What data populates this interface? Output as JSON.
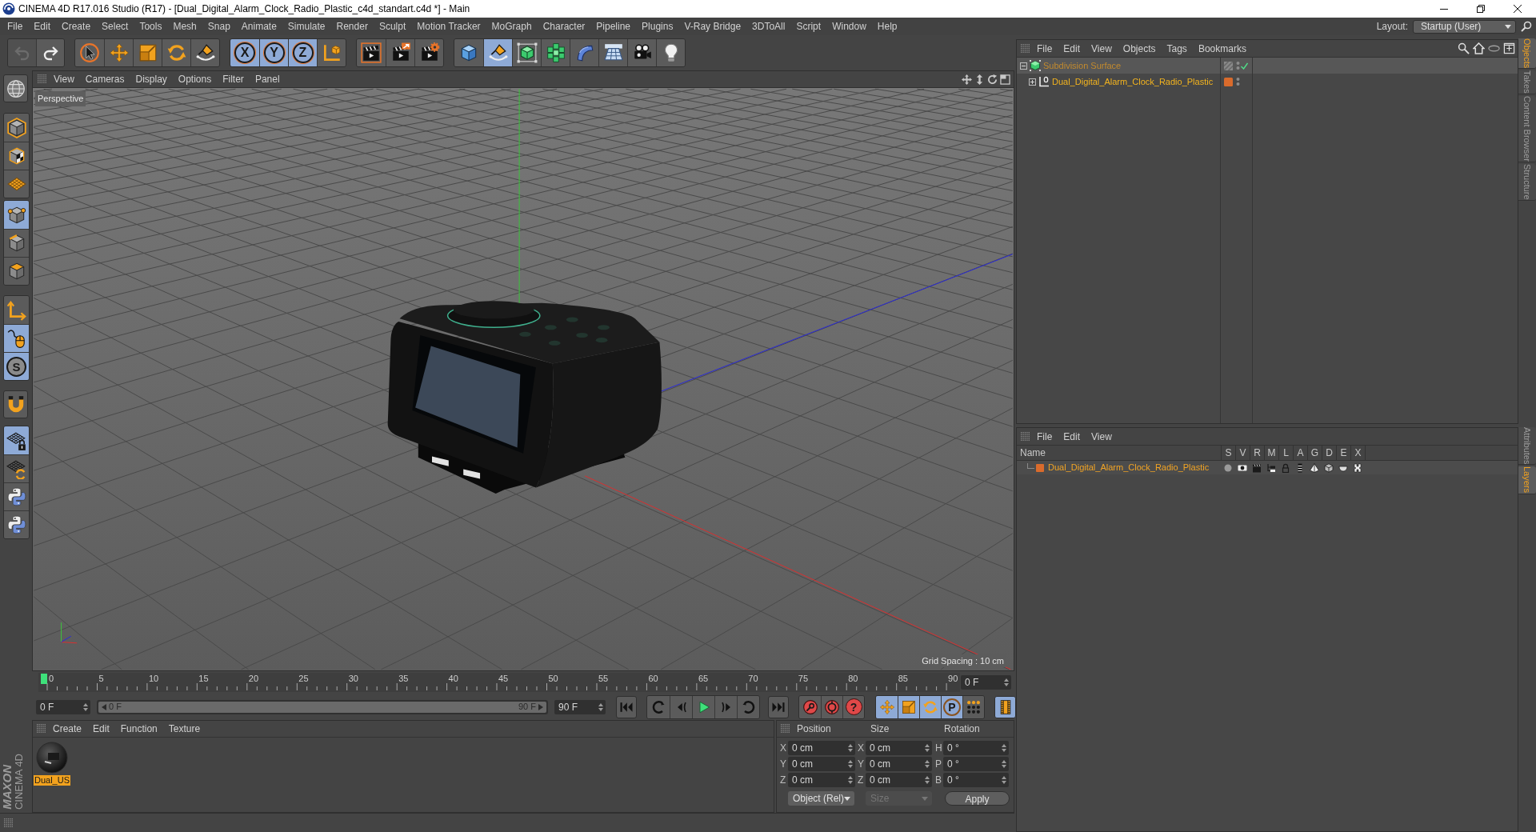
{
  "window": {
    "title": "CINEMA 4D R17.016 Studio (R17) - [Dual_Digital_Alarm_Clock_Radio_Plastic_c4d_standart.c4d *] - Main"
  },
  "menu_bar": {
    "items": [
      "File",
      "Edit",
      "Create",
      "Select",
      "Tools",
      "Mesh",
      "Snap",
      "Animate",
      "Simulate",
      "Render",
      "Sculpt",
      "Motion Tracker",
      "MoGraph",
      "Character",
      "Pipeline",
      "Plugins",
      "V-Ray Bridge",
      "3DToAll",
      "Script",
      "Window",
      "Help"
    ],
    "layout_label": "Layout:",
    "layout_value": "Startup (User)"
  },
  "toolbar": {
    "history": [
      {
        "kind": "undo",
        "disabled": true
      },
      {
        "kind": "redo",
        "disabled": false
      }
    ],
    "groups": [
      [
        {
          "kind": "select",
          "selected": false
        },
        {
          "kind": "move",
          "selected": false
        },
        {
          "kind": "scale",
          "selected": false
        },
        {
          "kind": "rotate",
          "selected": false
        },
        {
          "kind": "brush",
          "selected": false
        }
      ],
      [
        {
          "kind": "axis",
          "label": "X",
          "selected": true
        },
        {
          "kind": "axis",
          "label": "Y",
          "selected": true
        },
        {
          "kind": "axis",
          "label": "Z",
          "selected": true
        },
        {
          "kind": "coords",
          "selected": false
        }
      ],
      [
        {
          "kind": "render-view",
          "selected": false
        },
        {
          "kind": "render-picture",
          "selected": false
        },
        {
          "kind": "render-settings",
          "selected": false
        }
      ],
      [
        {
          "kind": "cube",
          "selected": false
        },
        {
          "kind": "pen",
          "selected": true
        },
        {
          "kind": "subdivision",
          "selected": false
        },
        {
          "kind": "cloner",
          "selected": false
        },
        {
          "kind": "deformer",
          "selected": false
        },
        {
          "kind": "floor",
          "selected": false
        },
        {
          "kind": "camera",
          "selected": false
        },
        {
          "kind": "light",
          "selected": false
        }
      ]
    ]
  },
  "left_toolbar": {
    "groups": [
      [
        {
          "kind": "make-editable",
          "selected": false
        }
      ],
      [
        {
          "kind": "model",
          "selected": false
        },
        {
          "kind": "texture",
          "selected": false
        },
        {
          "kind": "workplane",
          "selected": false
        }
      ],
      [
        {
          "kind": "points",
          "selected": true
        },
        {
          "kind": "edges",
          "selected": false
        },
        {
          "kind": "polygons",
          "selected": false
        }
      ],
      [
        {
          "kind": "axis-mode",
          "selected": false
        },
        {
          "kind": "tweak",
          "selected": true
        },
        {
          "kind": "solo",
          "label": "S",
          "selected": true
        }
      ],
      [
        {
          "kind": "snap",
          "selected": false
        }
      ],
      [
        {
          "kind": "workplane-lock",
          "selected": true
        },
        {
          "kind": "workplane-align",
          "selected": false
        },
        {
          "kind": "python",
          "selected": false
        },
        {
          "kind": "python",
          "selected": false
        }
      ]
    ]
  },
  "viewport": {
    "menu": [
      "View",
      "Cameras",
      "Display",
      "Options",
      "Filter",
      "Panel"
    ],
    "camera": "Perspective",
    "grid_spacing": "Grid Spacing : 10 cm"
  },
  "timeline": {
    "ticks": [
      "0",
      "5",
      "10",
      "15",
      "20",
      "25",
      "30",
      "35",
      "40",
      "45",
      "50",
      "55",
      "60",
      "65",
      "70",
      "75",
      "80",
      "85",
      "90"
    ],
    "playhead": {
      "level": 0
    },
    "frame_field": "0 F"
  },
  "playback": {
    "start_field": "0 F",
    "range": {
      "start": "0 F",
      "end": "90 F",
      "level": 1
    },
    "end_field": "90 F",
    "transport": [
      [
        {
          "kind": "go-start"
        }
      ],
      [
        {
          "kind": "prev-key"
        },
        {
          "kind": "prev-frame"
        },
        {
          "kind": "play"
        },
        {
          "kind": "next-frame"
        },
        {
          "kind": "next-key"
        }
      ],
      [
        {
          "kind": "go-end"
        }
      ]
    ],
    "record": [
      {
        "kind": "record-key"
      },
      {
        "kind": "auto-key"
      },
      {
        "kind": "key-selection",
        "label": "?"
      }
    ],
    "modes": [
      {
        "kind": "key-move",
        "selected": true
      },
      {
        "kind": "key-scale",
        "selected": true
      },
      {
        "kind": "key-rotate",
        "selected": true
      },
      {
        "kind": "param",
        "label": "P",
        "selected": true
      },
      {
        "kind": "dot-grid",
        "selected": false
      }
    ],
    "timeline_toggle": {
      "selected": true
    }
  },
  "material_manager": {
    "menu": [
      "Create",
      "Edit",
      "Function",
      "Texture"
    ],
    "materials": [
      {
        "name": "Dual_US",
        "selected": true
      }
    ]
  },
  "coordinates": {
    "headings": [
      "Position",
      "Size",
      "Rotation"
    ],
    "rows": [
      [
        {
          "axis": "X",
          "value": "0 cm"
        },
        {
          "axis": "X",
          "value": "0 cm"
        },
        {
          "axis": "H",
          "value": "0 °"
        }
      ],
      [
        {
          "axis": "Y",
          "value": "0 cm"
        },
        {
          "axis": "Y",
          "value": "0 cm"
        },
        {
          "axis": "P",
          "value": "0 °"
        }
      ],
      [
        {
          "axis": "Z",
          "value": "0 cm"
        },
        {
          "axis": "Z",
          "value": "0 cm"
        },
        {
          "axis": "B",
          "value": "0 °"
        }
      ]
    ],
    "dropdowns": [
      {
        "label": "Object (Rel)",
        "disabled": false
      },
      {
        "label": "Size",
        "disabled": true
      }
    ],
    "apply": "Apply"
  },
  "object_manager": {
    "menu": [
      "File",
      "Edit",
      "View",
      "Objects",
      "Tags",
      "Bookmarks"
    ],
    "objects": [
      {
        "name": "Subdivision Surface",
        "kind": "subdivision",
        "selected": true,
        "active": false,
        "expanded": true,
        "enabled": true,
        "children": [
          {
            "name": "Dual_Digital_Alarm_Clock_Radio_Plastic",
            "kind": "null",
            "selected": false,
            "active": true,
            "expanded": false,
            "enabled": false,
            "color": "#d96b2c"
          }
        ]
      }
    ]
  },
  "layer_manager": {
    "menu": [
      "File",
      "Edit",
      "View"
    ],
    "columns": [
      "Name",
      "S",
      "V",
      "R",
      "M",
      "L",
      "A",
      "G",
      "D",
      "E",
      "X"
    ],
    "layers": [
      {
        "name": "Dual_Digital_Alarm_Clock_Radio_Plastic",
        "color": "#d96b2c"
      }
    ]
  },
  "side_tabs": {
    "upper": [
      {
        "label": "Objects",
        "selected": true
      },
      {
        "label": "Takes",
        "selected": false
      },
      {
        "label": "Content Browser",
        "selected": false
      },
      {
        "label": "Structure",
        "selected": false
      }
    ],
    "lower": [
      {
        "label": "Attributes",
        "selected": false
      },
      {
        "label": "Layers",
        "selected": true
      }
    ]
  },
  "logo": {
    "brand": "MAXON",
    "product": "CINEMA 4D"
  }
}
